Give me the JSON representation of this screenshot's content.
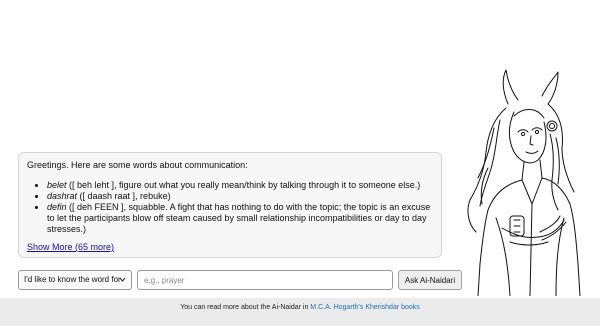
{
  "chat": {
    "greeting": "Greetings. Here are some words about communication:",
    "words": [
      {
        "term": "belet",
        "definition": " ([ beh leht ], figure out what you really mean/think by talking through it to someone else.)"
      },
      {
        "term": "dashrat",
        "definition": " ([ daash raat ], rebuke)"
      },
      {
        "term": "defin",
        "definition": " ([ deh FEEN ], squabble. A fight that has nothing to do with the topic; the topic is an excuse to let the participants blow off steam caused by small relationship incompatibilities or day to day stresses.)"
      }
    ],
    "show_more_label": "Show More (65 more)"
  },
  "query": {
    "mode_selected": "I'd like to know the word for",
    "input_placeholder": "e.g., prayer",
    "input_value": "",
    "ask_button_label": "Ask Ai-Naidari"
  },
  "footer": {
    "prefix": "You can read more about the Ai-Naidar in ",
    "link_text": "M.C.A. Hogarth's Kherishdar books"
  },
  "illustration": {
    "subject": "line-art portrait of horned Ai-Naidar character",
    "icon": "character-portrait"
  }
}
